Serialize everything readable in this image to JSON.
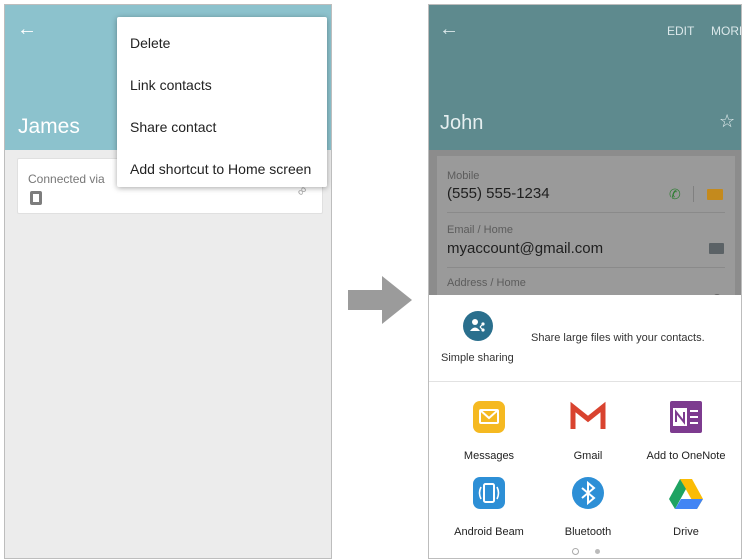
{
  "left": {
    "back_icon": "arrow-left-icon",
    "contact_name": "James",
    "connected_via_label": "Connected via",
    "device_icon": "phone-device-icon",
    "link_icon": "link-icon",
    "menu_items": [
      "Delete",
      "Link contacts",
      "Share contact",
      "Add shortcut to Home screen"
    ]
  },
  "arrow_icon": "right-arrow-icon",
  "right": {
    "back_icon": "arrow-left-icon",
    "edit_label": "EDIT",
    "more_label": "MORE",
    "contact_name": "John",
    "star_icon": "star-outline-icon",
    "details": {
      "mobile_label": "Mobile",
      "mobile_value": "(555) 555-1234",
      "email_label": "Email / Home",
      "email_value": "myaccount@gmail.com",
      "address_label": "Address / Home"
    },
    "share_sheet": {
      "simple_sharing_label": "Simple sharing",
      "simple_sharing_description": "Share large files with your contacts.",
      "apps": [
        {
          "label": "Messages",
          "icon": "messages-icon",
          "color": "#f5b921"
        },
        {
          "label": "Gmail",
          "icon": "gmail-icon",
          "color": "#d9432f"
        },
        {
          "label": "Add to OneNote",
          "icon": "onenote-icon",
          "color": "#7d3b8f"
        },
        {
          "label": "Android Beam",
          "icon": "android-beam-icon",
          "color": "#2d8fd6"
        },
        {
          "label": "Bluetooth",
          "icon": "bluetooth-icon",
          "color": "#2d8fd6"
        },
        {
          "label": "Drive",
          "icon": "drive-icon",
          "color": "#fbbc05"
        }
      ]
    }
  },
  "colors": {
    "left_header": "#8cc2cd",
    "right_header": "#5e8a8e",
    "dim_overlay": "#8c8c8c",
    "simple_sharing_blue": "#2a6f8d"
  }
}
